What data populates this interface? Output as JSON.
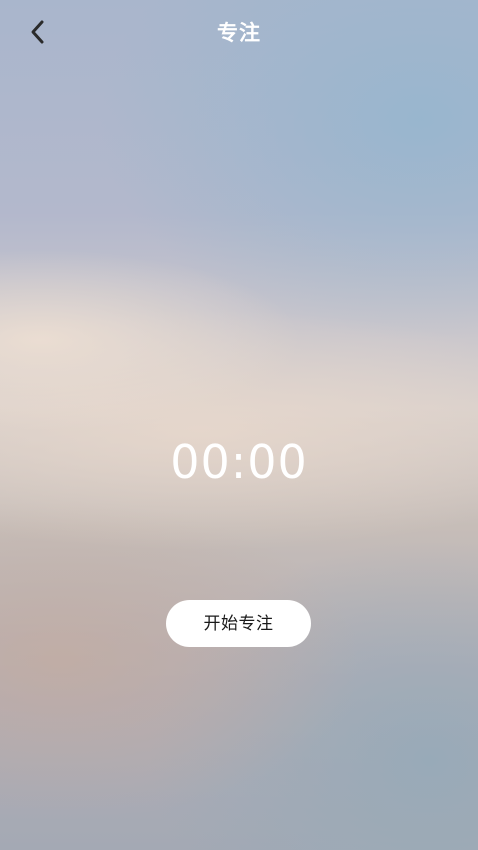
{
  "header": {
    "title": "专注",
    "back_icon": "chevron-left-icon"
  },
  "timer": {
    "value": "00:00"
  },
  "actions": {
    "start_label": "开始专注"
  },
  "colors": {
    "text": "#ffffff",
    "button_bg": "#ffffff",
    "button_text": "#1a1a1a",
    "back_icon": "#2b2b2b"
  }
}
